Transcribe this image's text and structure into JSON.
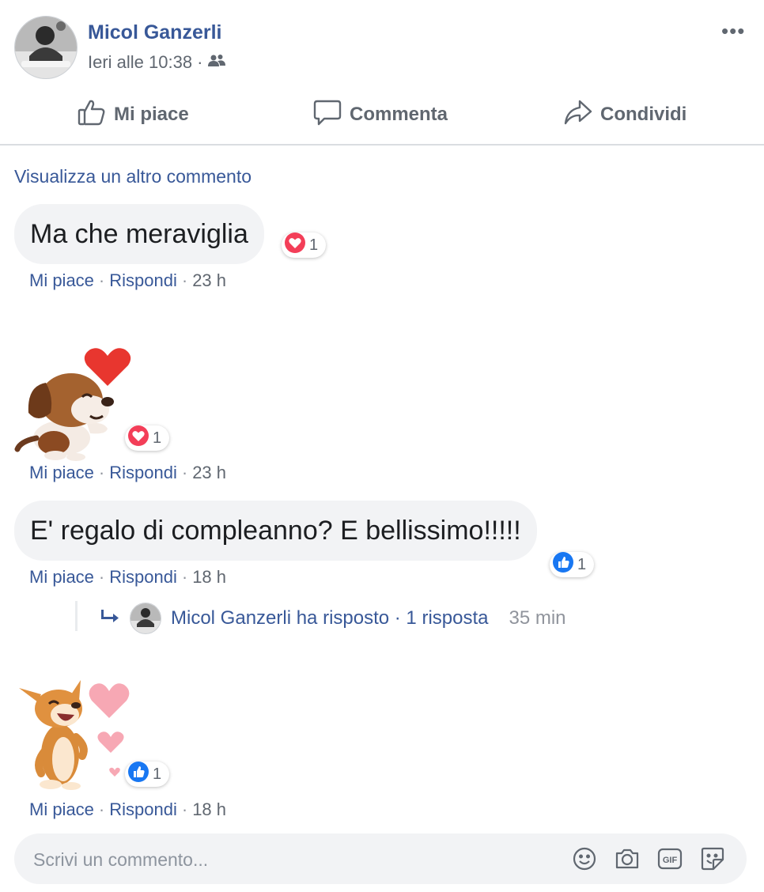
{
  "post": {
    "author": "Micol Ganzerli",
    "time": "Ieri alle 10:38",
    "separator": "·",
    "more": "•••"
  },
  "actions": {
    "like": "Mi piace",
    "comment": "Commenta",
    "share": "Condividi"
  },
  "view_more": "Visualizza un altro commento",
  "comments": [
    {
      "text": "Ma che meraviglia",
      "reaction": "love",
      "reaction_count": "1",
      "like": "Mi piace",
      "reply": "Rispondi",
      "time": "23 h"
    },
    {
      "sticker": "beagle-heart-sticker",
      "reaction": "love",
      "reaction_count": "1",
      "like": "Mi piace",
      "reply": "Rispondi",
      "time": "23 h"
    },
    {
      "text": "E' regalo di compleanno? E bellissimo!!!!!",
      "reaction": "like",
      "reaction_count": "1",
      "like": "Mi piace",
      "reply": "Rispondi",
      "time": "18 h",
      "replies": {
        "text": "Micol Ganzerli ha risposto · 1 risposta",
        "time": "35 min"
      }
    },
    {
      "sticker": "corgi-hearts-sticker",
      "reaction": "like",
      "reaction_count": "1",
      "like": "Mi piace",
      "reply": "Rispondi",
      "time": "18 h"
    }
  ],
  "composer": {
    "placeholder": "Scrivi un commento...",
    "tools": [
      "emoji-icon",
      "camera-icon",
      "gif-icon",
      "sticker-icon"
    ]
  },
  "colors": {
    "link": "#385898",
    "muted": "#606770",
    "bubble": "#f2f3f5",
    "love": "#f33e58",
    "like": "#1877f2"
  }
}
